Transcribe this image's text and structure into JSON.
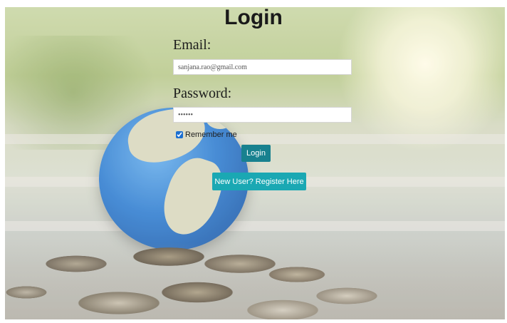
{
  "page": {
    "title": "Login",
    "accent_color": "#18818f",
    "register_color": "#1aa8b3"
  },
  "form": {
    "email_label": "Email:",
    "email_value": "sanjana.rao@gmail.com",
    "password_label": "Password:",
    "password_value": "••••••",
    "remember_label": "Remember me",
    "remember_checked": true,
    "login_button": "Login",
    "register_button": "New User? Register Here"
  },
  "background": {
    "icon": "globe-on-coins-photo"
  }
}
